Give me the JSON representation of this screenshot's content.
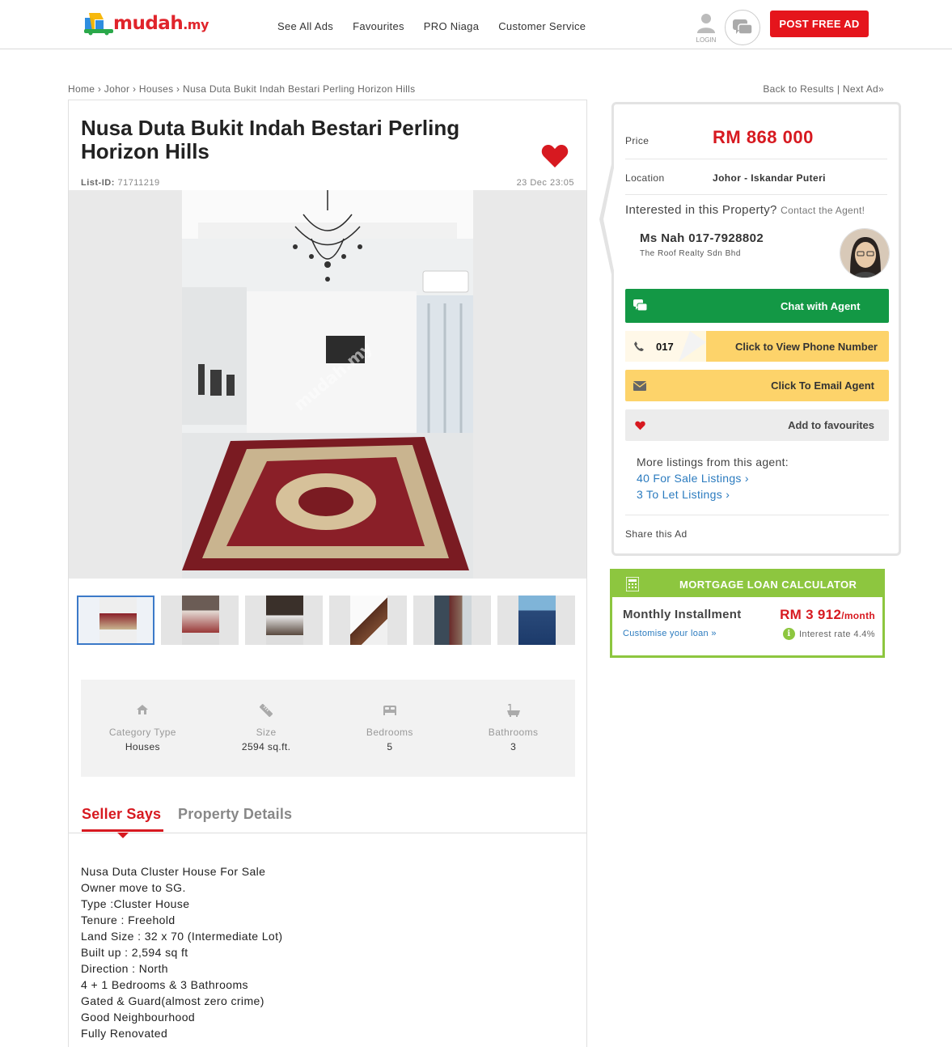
{
  "header": {
    "logo_text": "mudah",
    "logo_tld": ".my",
    "nav": [
      "See All Ads",
      "Favourites",
      "PRO Niaga",
      "Customer Service"
    ],
    "login_label": "LOGIN",
    "post_ad_label": "POST FREE AD"
  },
  "breadcrumb": {
    "items": [
      "Home",
      "Johor",
      "Houses",
      "Nusa Duta Bukit Indah Bestari Perling Horizon Hills"
    ],
    "separator": "›",
    "back_label": "Back to Results",
    "next_label": "Next Ad»"
  },
  "listing": {
    "title": "Nusa Duta Bukit Indah Bestari Perling Horizon Hills",
    "list_id_label": "List-ID:",
    "list_id": "71711219",
    "posted": "23 Dec 23:05",
    "watermark": "mudah.my",
    "thumb_count": 6,
    "attributes": [
      {
        "label": "Category Type",
        "value": "Houses",
        "icon": "house-icon"
      },
      {
        "label": "Size",
        "value": "2594 sq.ft.",
        "icon": "ruler-icon"
      },
      {
        "label": "Bedrooms",
        "value": "5",
        "icon": "bed-icon"
      },
      {
        "label": "Bathrooms",
        "value": "3",
        "icon": "bathtub-icon"
      }
    ],
    "tabs": [
      "Seller Says",
      "Property Details"
    ],
    "description": [
      "Nusa Duta Cluster House For Sale",
      "Owner move to SG.",
      "Type :Cluster House",
      "Tenure : Freehold",
      "Land Size : 32 x 70 (Intermediate Lot)",
      "Built up : 2,594 sq ft",
      "Direction : North",
      "4 + 1 Bedrooms & 3 Bathrooms",
      "Gated & Guard(almost zero crime)",
      "Good Neighbourhood",
      "Fully Renovated"
    ]
  },
  "sidebar": {
    "price_label": "Price",
    "price": "RM 868 000",
    "location_label": "Location",
    "location": "Johor - Iskandar Puteri",
    "interested": "Interested in this Property?",
    "contact": "Contact the Agent!",
    "agent_name": "Ms Nah 017-7928802",
    "agent_company": "The Roof Realty Sdn Bhd",
    "chat_label": "Chat with Agent",
    "phone_prefix": "017",
    "phone_label": "Click to View Phone Number",
    "email_label": "Click To Email Agent",
    "fav_label": "Add to favourites",
    "more_label": "More listings from this agent:",
    "sale_link": "40 For Sale Listings ›",
    "let_link": "3 To Let Listings ›",
    "share_label": "Share this Ad"
  },
  "mortgage": {
    "title": "MORTGAGE LOAN CALCULATOR",
    "installment_label": "Monthly Installment",
    "installment": "RM 3 912",
    "per": "/month",
    "customise": "Customise your loan »",
    "rate": "Interest rate 4.4%"
  },
  "colors": {
    "brand_red": "#e5151c",
    "chat_green": "#139845",
    "phone_yellow": "#fdd36a",
    "calc_green": "#8dc63f",
    "link_blue": "#2b7bbf"
  }
}
